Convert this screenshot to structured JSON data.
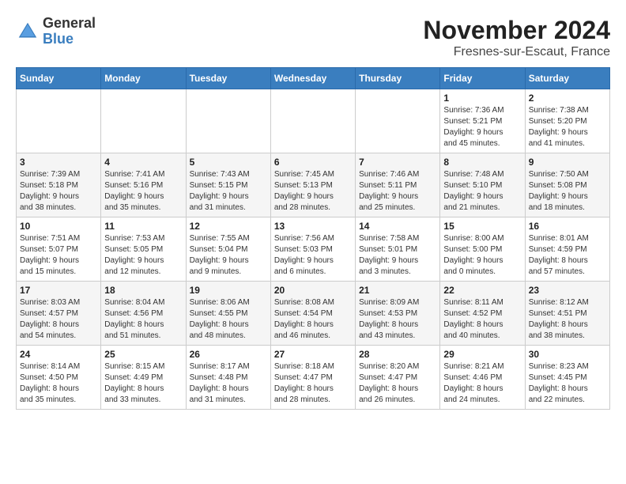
{
  "header": {
    "logo_general": "General",
    "logo_blue": "Blue",
    "month_year": "November 2024",
    "location": "Fresnes-sur-Escaut, France"
  },
  "days_of_week": [
    "Sunday",
    "Monday",
    "Tuesday",
    "Wednesday",
    "Thursday",
    "Friday",
    "Saturday"
  ],
  "weeks": [
    {
      "days": [
        {
          "number": "",
          "info": ""
        },
        {
          "number": "",
          "info": ""
        },
        {
          "number": "",
          "info": ""
        },
        {
          "number": "",
          "info": ""
        },
        {
          "number": "",
          "info": ""
        },
        {
          "number": "1",
          "info": "Sunrise: 7:36 AM\nSunset: 5:21 PM\nDaylight: 9 hours\nand 45 minutes."
        },
        {
          "number": "2",
          "info": "Sunrise: 7:38 AM\nSunset: 5:20 PM\nDaylight: 9 hours\nand 41 minutes."
        }
      ]
    },
    {
      "days": [
        {
          "number": "3",
          "info": "Sunrise: 7:39 AM\nSunset: 5:18 PM\nDaylight: 9 hours\nand 38 minutes."
        },
        {
          "number": "4",
          "info": "Sunrise: 7:41 AM\nSunset: 5:16 PM\nDaylight: 9 hours\nand 35 minutes."
        },
        {
          "number": "5",
          "info": "Sunrise: 7:43 AM\nSunset: 5:15 PM\nDaylight: 9 hours\nand 31 minutes."
        },
        {
          "number": "6",
          "info": "Sunrise: 7:45 AM\nSunset: 5:13 PM\nDaylight: 9 hours\nand 28 minutes."
        },
        {
          "number": "7",
          "info": "Sunrise: 7:46 AM\nSunset: 5:11 PM\nDaylight: 9 hours\nand 25 minutes."
        },
        {
          "number": "8",
          "info": "Sunrise: 7:48 AM\nSunset: 5:10 PM\nDaylight: 9 hours\nand 21 minutes."
        },
        {
          "number": "9",
          "info": "Sunrise: 7:50 AM\nSunset: 5:08 PM\nDaylight: 9 hours\nand 18 minutes."
        }
      ]
    },
    {
      "days": [
        {
          "number": "10",
          "info": "Sunrise: 7:51 AM\nSunset: 5:07 PM\nDaylight: 9 hours\nand 15 minutes."
        },
        {
          "number": "11",
          "info": "Sunrise: 7:53 AM\nSunset: 5:05 PM\nDaylight: 9 hours\nand 12 minutes."
        },
        {
          "number": "12",
          "info": "Sunrise: 7:55 AM\nSunset: 5:04 PM\nDaylight: 9 hours\nand 9 minutes."
        },
        {
          "number": "13",
          "info": "Sunrise: 7:56 AM\nSunset: 5:03 PM\nDaylight: 9 hours\nand 6 minutes."
        },
        {
          "number": "14",
          "info": "Sunrise: 7:58 AM\nSunset: 5:01 PM\nDaylight: 9 hours\nand 3 minutes."
        },
        {
          "number": "15",
          "info": "Sunrise: 8:00 AM\nSunset: 5:00 PM\nDaylight: 9 hours\nand 0 minutes."
        },
        {
          "number": "16",
          "info": "Sunrise: 8:01 AM\nSunset: 4:59 PM\nDaylight: 8 hours\nand 57 minutes."
        }
      ]
    },
    {
      "days": [
        {
          "number": "17",
          "info": "Sunrise: 8:03 AM\nSunset: 4:57 PM\nDaylight: 8 hours\nand 54 minutes."
        },
        {
          "number": "18",
          "info": "Sunrise: 8:04 AM\nSunset: 4:56 PM\nDaylight: 8 hours\nand 51 minutes."
        },
        {
          "number": "19",
          "info": "Sunrise: 8:06 AM\nSunset: 4:55 PM\nDaylight: 8 hours\nand 48 minutes."
        },
        {
          "number": "20",
          "info": "Sunrise: 8:08 AM\nSunset: 4:54 PM\nDaylight: 8 hours\nand 46 minutes."
        },
        {
          "number": "21",
          "info": "Sunrise: 8:09 AM\nSunset: 4:53 PM\nDaylight: 8 hours\nand 43 minutes."
        },
        {
          "number": "22",
          "info": "Sunrise: 8:11 AM\nSunset: 4:52 PM\nDaylight: 8 hours\nand 40 minutes."
        },
        {
          "number": "23",
          "info": "Sunrise: 8:12 AM\nSunset: 4:51 PM\nDaylight: 8 hours\nand 38 minutes."
        }
      ]
    },
    {
      "days": [
        {
          "number": "24",
          "info": "Sunrise: 8:14 AM\nSunset: 4:50 PM\nDaylight: 8 hours\nand 35 minutes."
        },
        {
          "number": "25",
          "info": "Sunrise: 8:15 AM\nSunset: 4:49 PM\nDaylight: 8 hours\nand 33 minutes."
        },
        {
          "number": "26",
          "info": "Sunrise: 8:17 AM\nSunset: 4:48 PM\nDaylight: 8 hours\nand 31 minutes."
        },
        {
          "number": "27",
          "info": "Sunrise: 8:18 AM\nSunset: 4:47 PM\nDaylight: 8 hours\nand 28 minutes."
        },
        {
          "number": "28",
          "info": "Sunrise: 8:20 AM\nSunset: 4:47 PM\nDaylight: 8 hours\nand 26 minutes."
        },
        {
          "number": "29",
          "info": "Sunrise: 8:21 AM\nSunset: 4:46 PM\nDaylight: 8 hours\nand 24 minutes."
        },
        {
          "number": "30",
          "info": "Sunrise: 8:23 AM\nSunset: 4:45 PM\nDaylight: 8 hours\nand 22 minutes."
        }
      ]
    }
  ]
}
